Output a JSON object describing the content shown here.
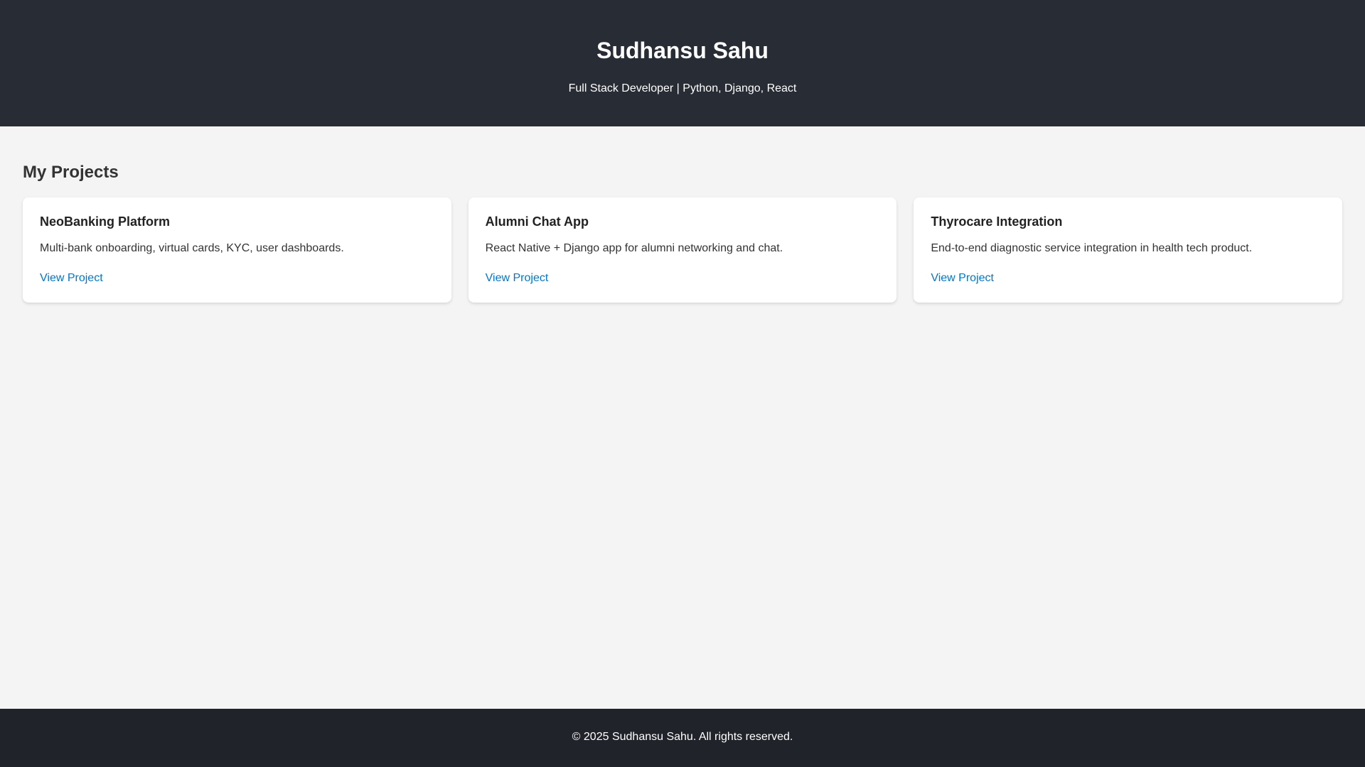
{
  "header": {
    "title": "Sudhansu Sahu",
    "subtitle": "Full Stack Developer | Python, Django, React"
  },
  "projects_section": {
    "title": "My Projects",
    "items": [
      {
        "title": "NeoBanking Platform",
        "description": "Multi-bank onboarding, virtual cards, KYC, user dashboards.",
        "link_label": "View Project"
      },
      {
        "title": "Alumni Chat App",
        "description": "React Native + Django app for alumni networking and chat.",
        "link_label": "View Project"
      },
      {
        "title": "Thyrocare Integration",
        "description": "End-to-end diagnostic service integration in health tech product.",
        "link_label": "View Project"
      }
    ]
  },
  "footer": {
    "text": "© 2025 Sudhansu Sahu. All rights reserved."
  },
  "colors": {
    "header_bg": "#282c34",
    "footer_bg": "#20232a",
    "page_bg": "#f4f4f4",
    "link": "#0077cc"
  }
}
